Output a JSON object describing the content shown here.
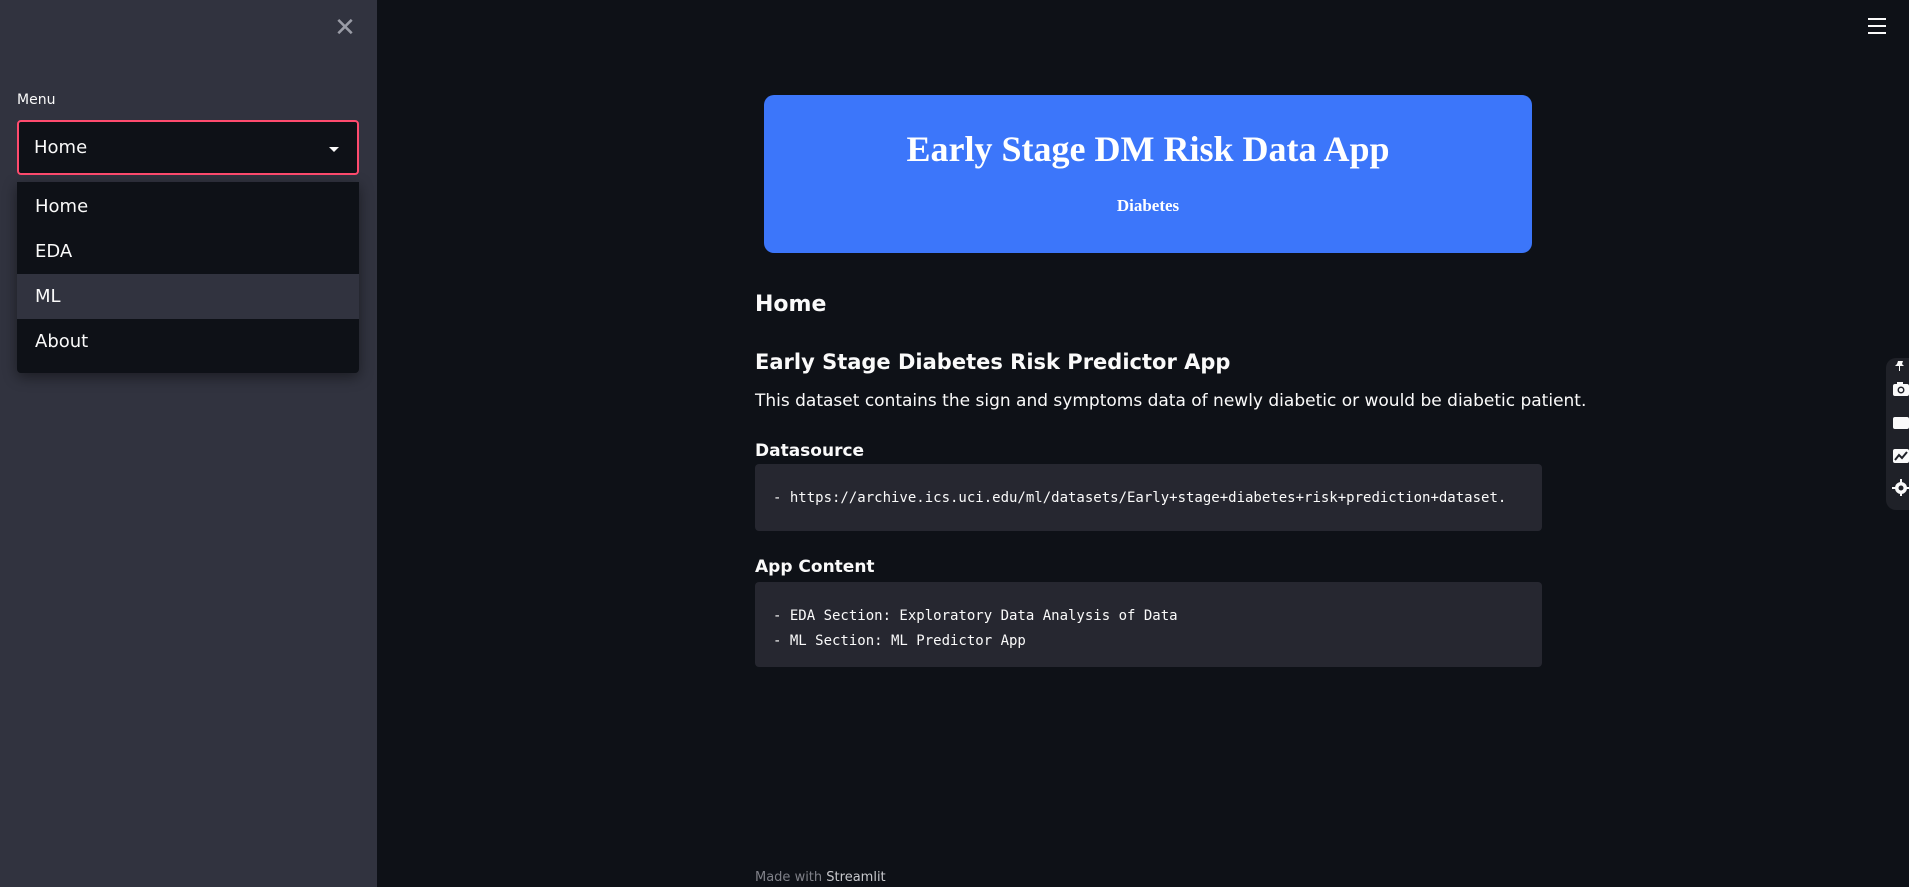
{
  "sidebar": {
    "close_icon": "close-icon",
    "menu_label": "Menu",
    "selected": "Home",
    "options": [
      "Home",
      "EDA",
      "ML",
      "About"
    ],
    "hovered_option": "ML",
    "accent_color": "#ff4b6e"
  },
  "header": {
    "menu_icon": "hamburger-icon"
  },
  "banner": {
    "title": "Early Stage DM Risk Data App",
    "subtitle": "Diabetes",
    "color": "#3c76fa"
  },
  "main": {
    "page_title": "Home",
    "heading": "Early Stage Diabetes Risk Predictor App",
    "description": "This dataset contains the sign and symptoms data of newly diabetic or would be diabetic patient.",
    "datasource": {
      "label": "Datasource",
      "lines": [
        "- https://archive.ics.uci.edu/ml/datasets/Early+stage+diabetes+risk+prediction+dataset."
      ]
    },
    "app_content": {
      "label": "App Content",
      "lines": [
        "- EDA Section: Exploratory Data Analysis of Data",
        "- ML Section: ML Predictor App"
      ]
    }
  },
  "footer": {
    "prefix": "Made with",
    "link": "Streamlit"
  },
  "toolbar": {
    "icons": [
      "pin-icon",
      "camera-icon",
      "video-icon",
      "chart-icon",
      "gear-icon"
    ]
  }
}
